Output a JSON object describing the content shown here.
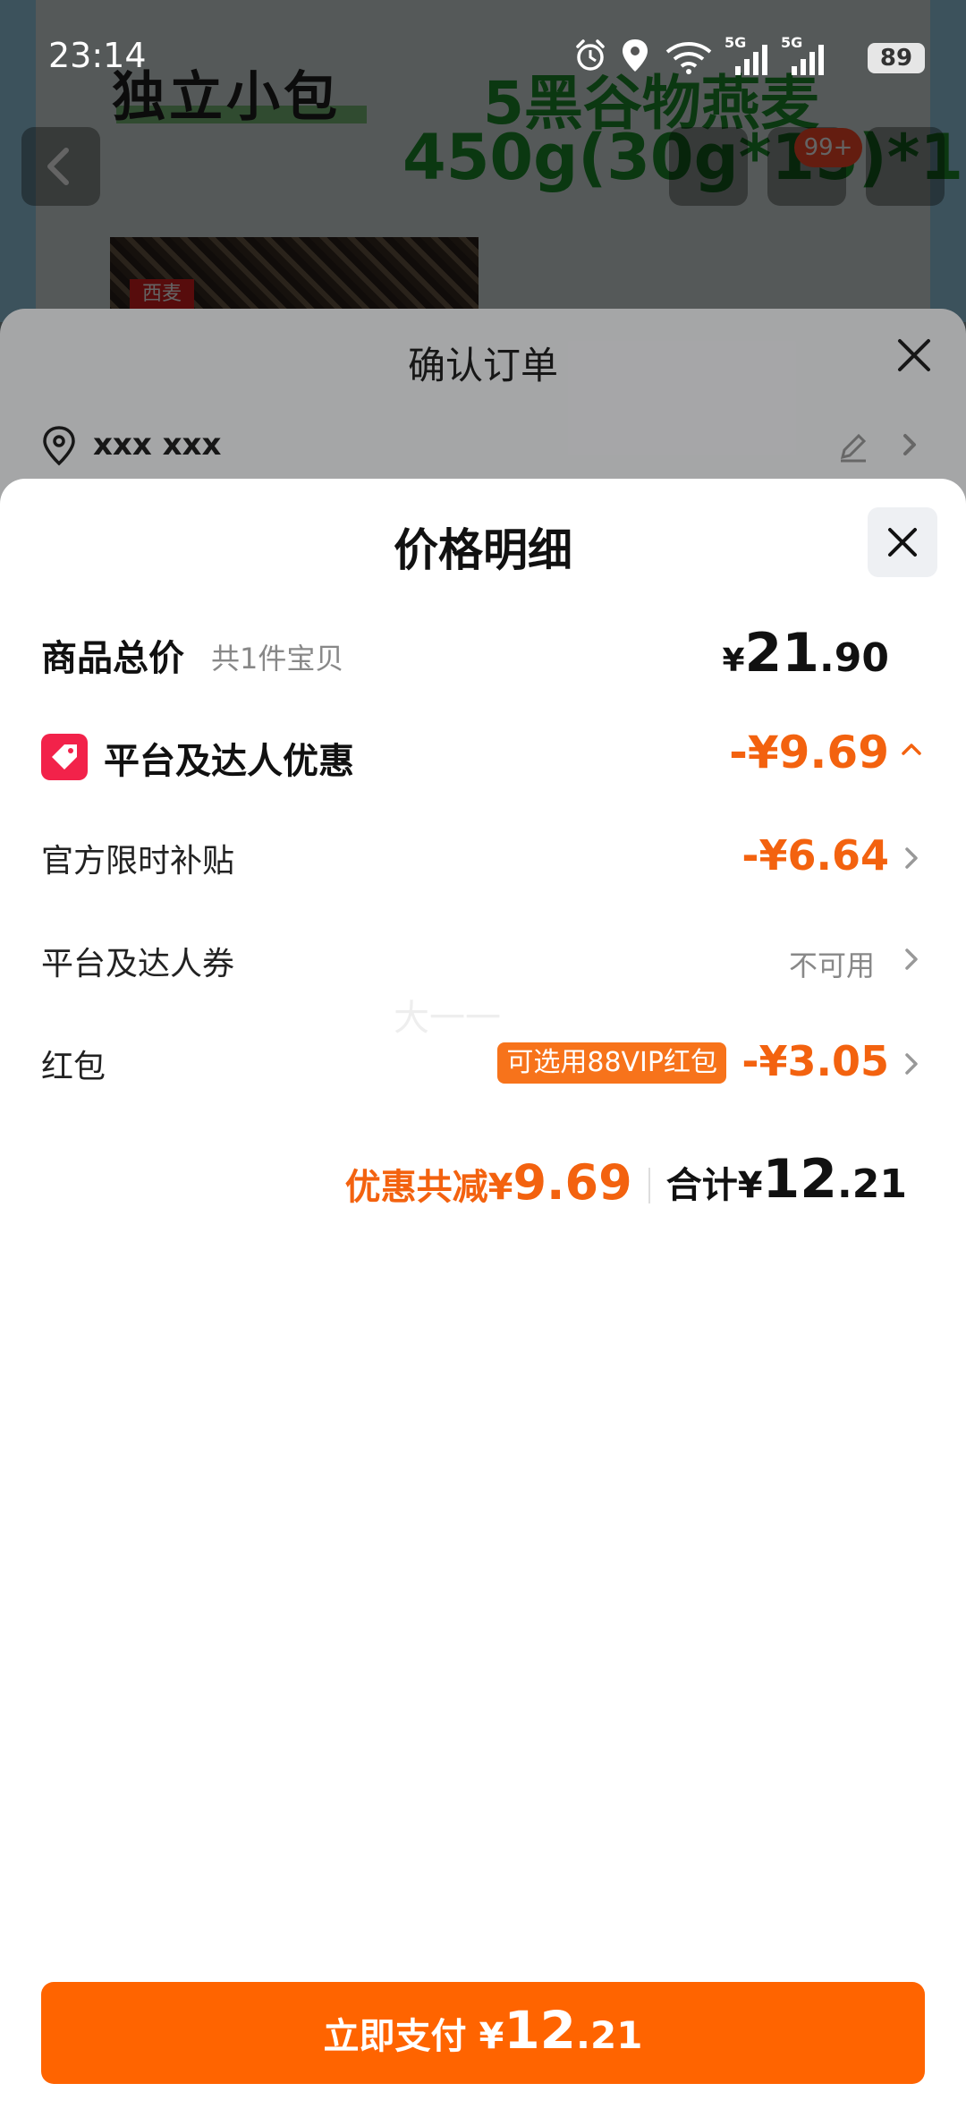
{
  "status_bar": {
    "time": "23:14",
    "battery": "89",
    "network_1": "5G",
    "network_2": "5G"
  },
  "background_page": {
    "banner_left": "独立小包",
    "banner_right_line1": "5黑谷物燕麦",
    "banner_right_line2": "450g(30g*15)*1",
    "product_tag": "西麦",
    "cart_badge": "99+"
  },
  "confirm_order": {
    "title": "确认订单",
    "address": "xxx xxx"
  },
  "price_detail": {
    "title": "价格明细",
    "total": {
      "label": "商品总价",
      "sub": "共1件宝贝",
      "currency": "¥",
      "integer": "21",
      "decimal": ".90"
    },
    "promo": {
      "label": "平台及达人优惠",
      "value": "-¥9.69"
    },
    "rows": [
      {
        "label": "官方限时补贴",
        "value": "-¥6.64"
      },
      {
        "label": "平台及达人券",
        "value": "不可用"
      },
      {
        "label": "红包",
        "tag": "可选用88VIP红包",
        "value": "-¥3.05"
      }
    ],
    "summary": {
      "discount_label": "优惠共减¥",
      "discount_value": "9.69",
      "total_label": "合计¥",
      "total_integer": "12",
      "total_decimal": ".21"
    },
    "pay_button": {
      "label": "立即支付 ¥",
      "integer": "12",
      "decimal": ".21"
    },
    "watermark": "大一一"
  },
  "colors": {
    "accent": "#ff6400",
    "discount": "#f3620f",
    "promo_icon": "#f2224a"
  }
}
